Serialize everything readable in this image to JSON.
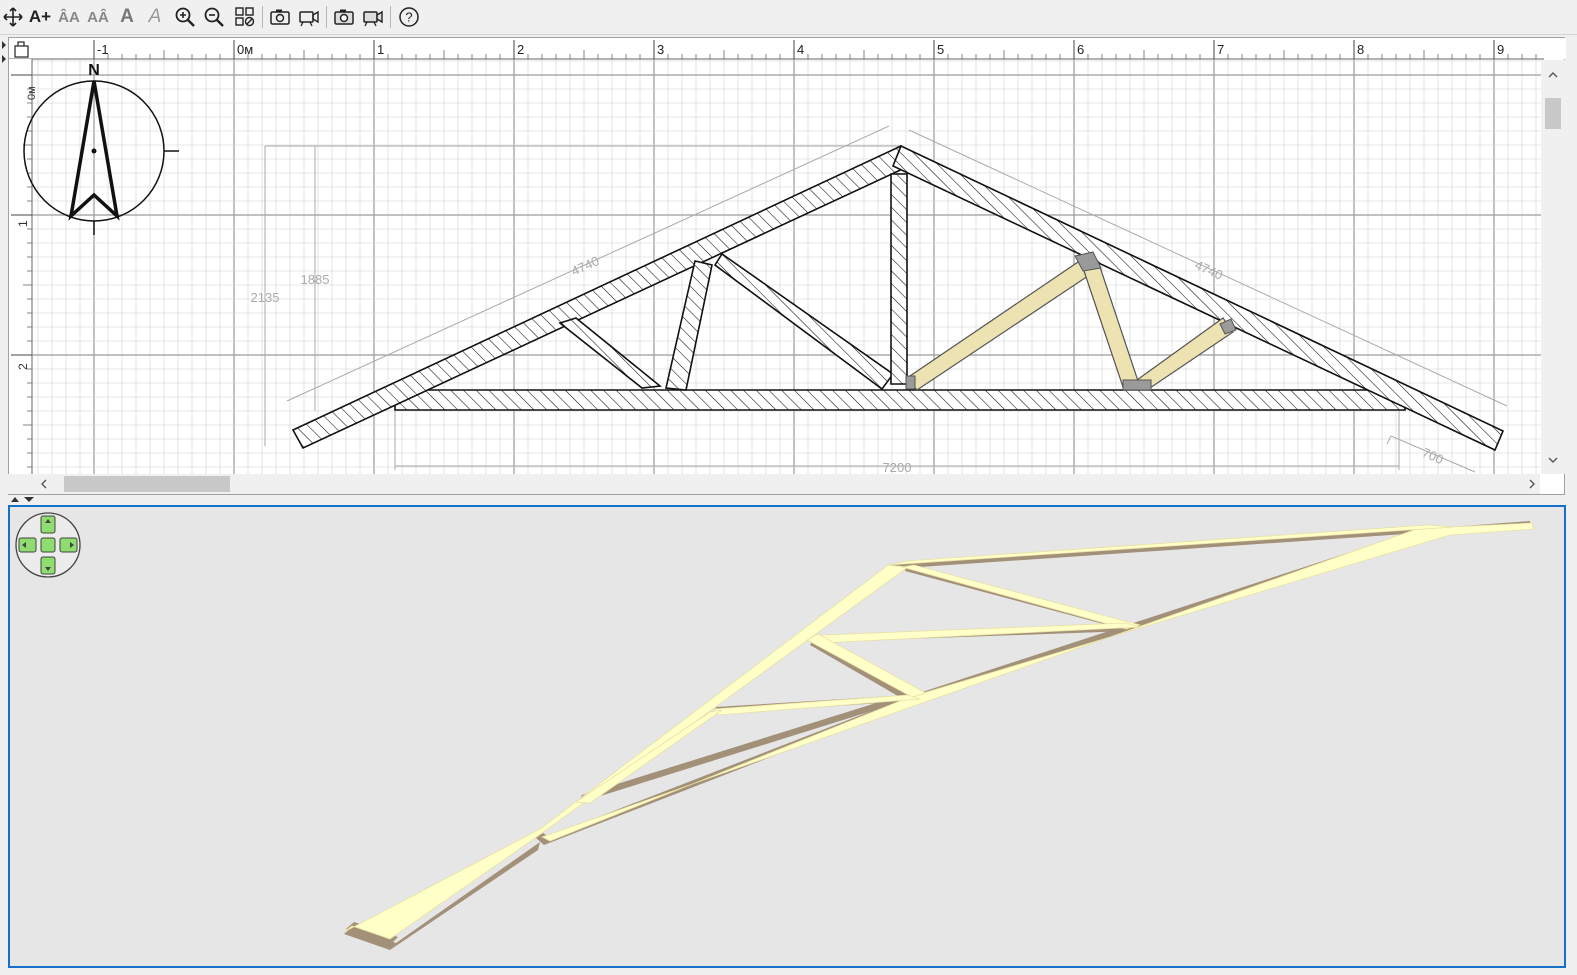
{
  "toolbar": {
    "buttons": [
      {
        "name": "move-tool-button",
        "icon": "move-cross-icon",
        "glyph": ""
      },
      {
        "name": "add-text-button",
        "icon": "text-add-icon",
        "glyph": "A+"
      },
      {
        "name": "font-increase-button",
        "icon": "font-increase-icon",
        "glyph": "ÂA"
      },
      {
        "name": "font-decrease-button",
        "icon": "font-decrease-icon",
        "glyph": "AÂ"
      },
      {
        "name": "bold-button",
        "icon": "bold-icon",
        "glyph": "A"
      },
      {
        "name": "italic-button",
        "icon": "italic-icon",
        "glyph": "A"
      },
      {
        "name": "zoom-in-button",
        "icon": "zoom-in-icon",
        "glyph": ""
      },
      {
        "name": "zoom-out-button",
        "icon": "zoom-out-icon",
        "glyph": ""
      },
      {
        "name": "zoom-fit-button",
        "icon": "zoom-fit-icon",
        "glyph": ""
      },
      {
        "name": "snapshot-plan-button",
        "icon": "camera-icon",
        "glyph": ""
      },
      {
        "name": "record-plan-button",
        "icon": "video-camera-icon",
        "glyph": ""
      },
      {
        "name": "snapshot-3d-button",
        "icon": "camera-3d-icon",
        "glyph": ""
      },
      {
        "name": "record-3d-button",
        "icon": "video-camera-3d-icon",
        "glyph": ""
      },
      {
        "name": "help-button",
        "icon": "help-icon",
        "glyph": "?"
      }
    ]
  },
  "plan": {
    "ruler_top_labels": [
      "-1",
      "0м",
      "1",
      "2",
      "3",
      "4",
      "5",
      "6",
      "7",
      "8",
      "9"
    ],
    "ruler_left_labels": [
      "0м",
      "1",
      "2"
    ],
    "compass_label": "N",
    "dimensions": {
      "left_rafter": "4740",
      "right_rafter": "4740",
      "total_height": "2135",
      "inner_height": "1885",
      "span": "7200",
      "overhang": "700"
    },
    "colors": {
      "grid_minor": "#d0d0d0",
      "grid_major": "#9a9a9a",
      "member_outline": "#111111",
      "selected_member": "#ece2b2",
      "dimension": "#aaaaaa"
    }
  },
  "scrollbars": {
    "left_arrow": "<",
    "right_arrow": ">",
    "up_arrow": "^",
    "down_arrow": "v"
  },
  "view3d": {
    "navigator": "navigation-pad-icon",
    "colors": {
      "wood_top": "#ffffc8",
      "wood_side": "#a39078",
      "background": "#e6e6e6",
      "focus_border": "#1670c8"
    }
  }
}
